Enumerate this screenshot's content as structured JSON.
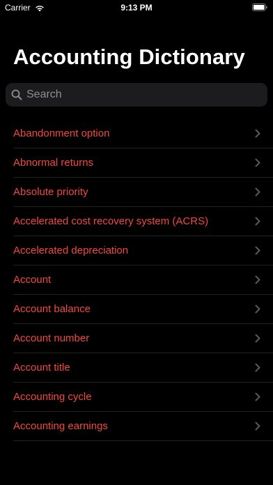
{
  "status_bar": {
    "carrier": "Carrier",
    "time": "9:13 PM"
  },
  "header": {
    "title": "Accounting Dictionary"
  },
  "search": {
    "placeholder": "Search",
    "value": ""
  },
  "list": {
    "items": [
      {
        "label": "Abandonment option"
      },
      {
        "label": "Abnormal returns"
      },
      {
        "label": "Absolute priority"
      },
      {
        "label": "Accelerated cost recovery system (ACRS)"
      },
      {
        "label": "Accelerated depreciation"
      },
      {
        "label": "Account"
      },
      {
        "label": "Account balance"
      },
      {
        "label": "Account number"
      },
      {
        "label": "Account title"
      },
      {
        "label": "Accounting cycle"
      },
      {
        "label": "Accounting earnings"
      }
    ]
  },
  "colors": {
    "accent": "#f0493f",
    "background": "#000000",
    "search_bg": "#1c1c1e",
    "separator": "#222224",
    "chevron": "#5a5a5e"
  }
}
